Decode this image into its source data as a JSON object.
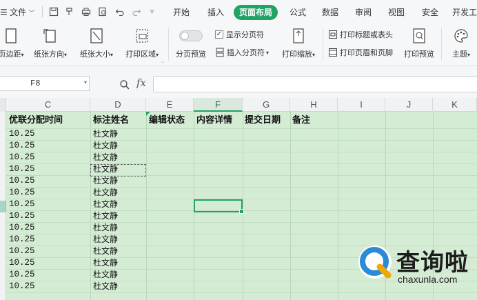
{
  "menubar": {
    "file_label": "文件",
    "tabs": [
      "开始",
      "插入",
      "页面布局",
      "公式",
      "数据",
      "审阅",
      "视图",
      "安全",
      "开发工"
    ],
    "active_tab": "页面布局"
  },
  "ribbon": {
    "margins": "页边距",
    "orientation": "纸张方向",
    "size": "纸张大小",
    "print_area": "打印区域",
    "page_break_preview": "分页预览",
    "show_page_breaks": "显示分页符",
    "insert_page_break": "插入分页符",
    "print_scaling": "打印缩放",
    "print_titles": "打印标题或表头",
    "header_footer": "打印页眉和页脚",
    "print_preview": "打印预览",
    "theme": "主题"
  },
  "formula_bar": {
    "name_box": "F8",
    "fx": "fx",
    "formula": ""
  },
  "columns": [
    "C",
    "D",
    "E",
    "F",
    "G",
    "H",
    "I",
    "J",
    "K"
  ],
  "selected_column": "F",
  "headers": [
    "优联分配时间",
    "标注姓名",
    "编辑状态",
    "内容详情",
    "提交日期",
    "备注"
  ],
  "rows": [
    [
      "10.25",
      "杜文静"
    ],
    [
      "10.25",
      "杜文静"
    ],
    [
      "10.25",
      "杜文静"
    ],
    [
      "10.25",
      "杜文静"
    ],
    [
      "10.25",
      "杜文静"
    ],
    [
      "10.25",
      "杜文静"
    ],
    [
      "10.25",
      "杜文静"
    ],
    [
      "10.25",
      "杜文静"
    ],
    [
      "10.25",
      "杜文静"
    ],
    [
      "10.25",
      "杜文静"
    ],
    [
      "10.25",
      "杜文静"
    ],
    [
      "10.25",
      "杜文静"
    ],
    [
      "10.25",
      "杜文静"
    ],
    [
      "10.25",
      "杜文静"
    ]
  ],
  "watermark": {
    "brand": "查询啦",
    "url": "chaxunla.com"
  },
  "colors": {
    "accent": "#21a366",
    "grid_fill": "#d4ecd4"
  }
}
